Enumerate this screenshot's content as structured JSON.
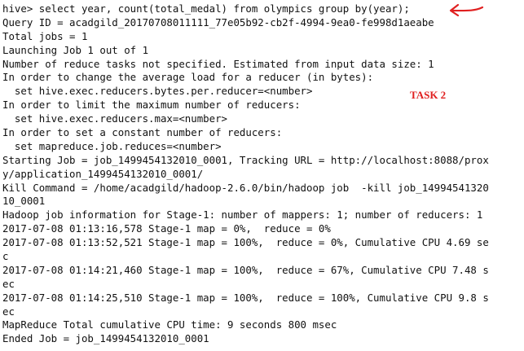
{
  "terminal": {
    "lines": [
      "hive> select year, count(total_medal) from olympics group by(year);",
      "Query ID = acadgild_20170708011111_77e05b92-cb2f-4994-9ea0-fe998d1aeabe",
      "Total jobs = 1",
      "Launching Job 1 out of 1",
      "Number of reduce tasks not specified. Estimated from input data size: 1",
      "In order to change the average load for a reducer (in bytes):",
      "  set hive.exec.reducers.bytes.per.reducer=<number>",
      "In order to limit the maximum number of reducers:",
      "  set hive.exec.reducers.max=<number>",
      "In order to set a constant number of reducers:",
      "  set mapreduce.job.reduces=<number>",
      "Starting Job = job_1499454132010_0001, Tracking URL = http://localhost:8088/prox",
      "y/application_1499454132010_0001/",
      "Kill Command = /home/acadgild/hadoop-2.6.0/bin/hadoop job  -kill job_14994541320",
      "10_0001",
      "Hadoop job information for Stage-1: number of mappers: 1; number of reducers: 1",
      "2017-07-08 01:13:16,578 Stage-1 map = 0%,  reduce = 0%",
      "2017-07-08 01:13:52,521 Stage-1 map = 100%,  reduce = 0%, Cumulative CPU 4.69 se",
      "c",
      "2017-07-08 01:14:21,460 Stage-1 map = 100%,  reduce = 67%, Cumulative CPU 7.48 s",
      "ec",
      "2017-07-08 01:14:25,510 Stage-1 map = 100%,  reduce = 100%, Cumulative CPU 9.8 s",
      "ec",
      "MapReduce Total cumulative CPU time: 9 seconds 800 msec",
      "Ended Job = job_1499454132010_0001"
    ]
  },
  "annotation": {
    "label": "TASK 2",
    "color": "#e02020",
    "arrow_icon": "arrow-left-icon"
  }
}
